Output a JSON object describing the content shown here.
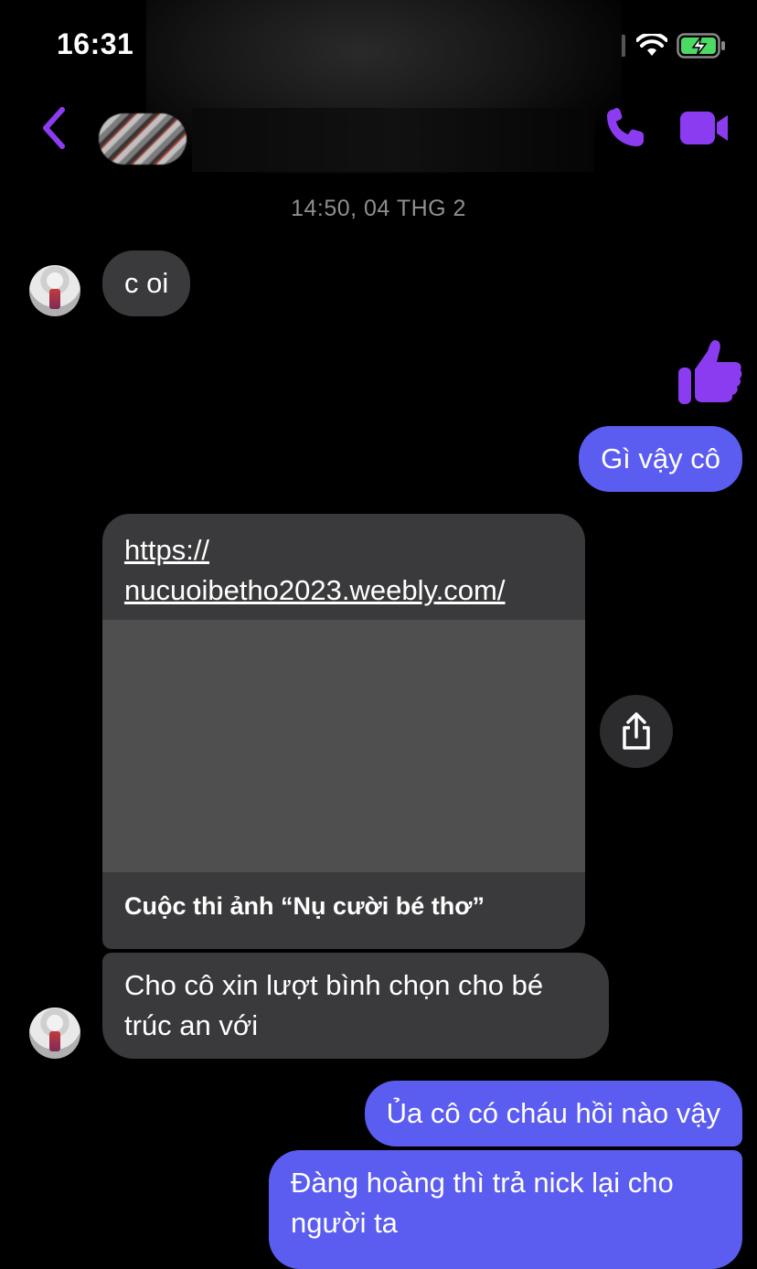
{
  "status_bar": {
    "time": "16:31"
  },
  "colors": {
    "accent": "#7c3aed",
    "outgoing_bubble": "#5b5cf0",
    "incoming_bubble": "#3a3a3c"
  },
  "icons": {
    "back": "chevron-left-icon",
    "call": "phone-icon",
    "video": "video-camera-icon",
    "like": "thumbs-up-icon",
    "share": "share-icon"
  },
  "conversation": {
    "timestamp": "14:50, 04 THG 2",
    "messages": [
      {
        "direction": "in",
        "text": "c oi"
      },
      {
        "direction": "out",
        "type": "like"
      },
      {
        "direction": "out",
        "text": "Gì vậy cô"
      },
      {
        "direction": "in",
        "type": "link",
        "url": "https://nucuoibetho2023.weebly.com/",
        "url_line1": "https://",
        "url_line2": "nucuoibetho2023.weebly.com/",
        "title": "Cuộc thi ảnh “Nụ cười bé thơ”"
      },
      {
        "direction": "in",
        "text": "Cho cô xin lượt bình chọn cho bé trúc an với"
      },
      {
        "direction": "out",
        "text": "Ủa cô có cháu hồi nào vậy"
      },
      {
        "direction": "out",
        "text": "Đàng hoàng thì trả nick lại cho người ta"
      }
    ]
  }
}
